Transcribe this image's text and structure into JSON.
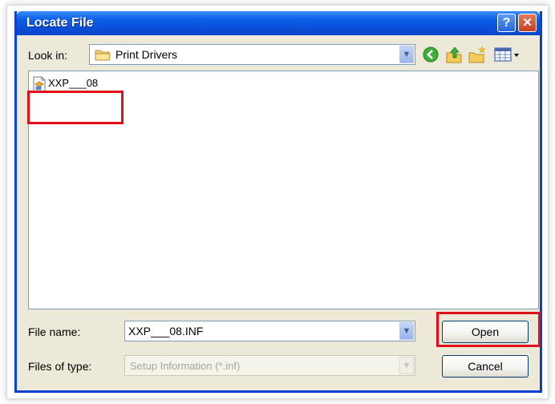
{
  "dialog": {
    "title": "Locate File",
    "help_label": "?",
    "close_label": "✕"
  },
  "toolbar": {
    "look_in_label": "Look in:",
    "look_in_value": "Print Drivers",
    "icons": [
      "back-icon",
      "up-folder-icon",
      "new-folder-icon",
      "views-menu-icon"
    ]
  },
  "file_list": {
    "items": [
      {
        "name": "XXP___08",
        "icon": "setup-information-file-icon"
      }
    ]
  },
  "fields": {
    "file_name_label": "File name:",
    "file_name_value": "XXP___08.INF",
    "file_type_label": "Files of type:",
    "file_type_value": "Setup Information (*.inf)"
  },
  "buttons": {
    "open_label": "Open",
    "cancel_label": "Cancel"
  },
  "colors": {
    "titlebar": "#0a4fd8",
    "dialog_face": "#ece9d8",
    "highlight": "#e0101a"
  }
}
